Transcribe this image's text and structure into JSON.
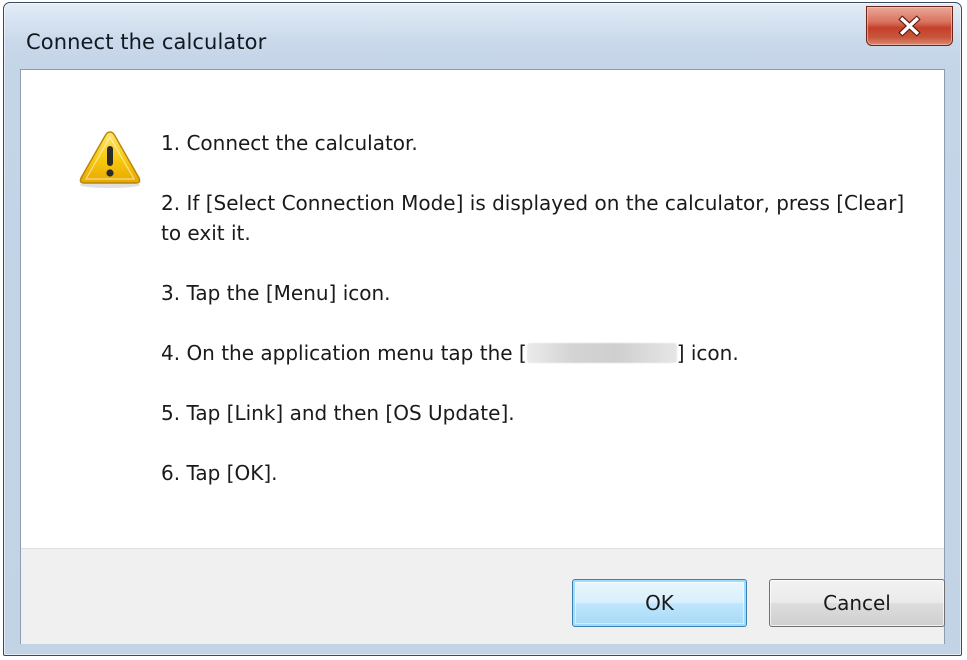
{
  "window": {
    "title": "Connect the calculator"
  },
  "icons": {
    "warning": "warning-icon",
    "close": "close-icon"
  },
  "steps": [
    {
      "text_before": "1. Connect the calculator.",
      "text_after": ""
    },
    {
      "text_before": "2. If [Select Connection Mode] is displayed on the calculator, press [Clear] to exit it.",
      "text_after": ""
    },
    {
      "text_before": "3. Tap the [Menu] icon.",
      "text_after": ""
    },
    {
      "text_before": "4. On the application menu tap the [",
      "text_after": "] icon."
    },
    {
      "text_before": "5. Tap [Link] and then [OS Update].",
      "text_after": ""
    },
    {
      "text_before": "6. Tap [OK].",
      "text_after": ""
    }
  ],
  "buttons": {
    "ok_label": "OK",
    "cancel_label": "Cancel"
  },
  "colors": {
    "close_button": "#c5412b",
    "ok_button_border": "#3c7fb1",
    "warning_yellow": "#f5c400"
  }
}
